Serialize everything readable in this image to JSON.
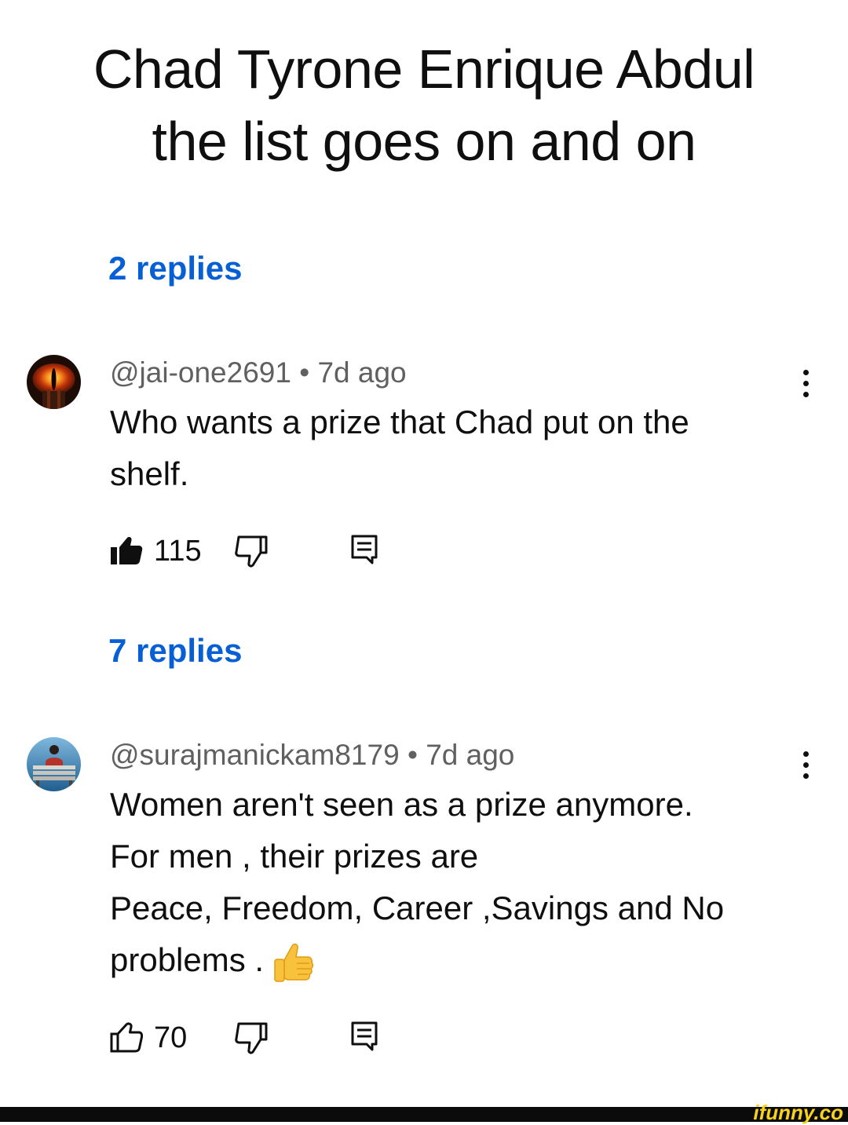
{
  "post": {
    "title_line1": "Chad Tyrone Enrique Abdul",
    "title_line2": "the list goes on and on"
  },
  "replies_link_1": "2 replies",
  "comments": [
    {
      "author": "@jai-one2691",
      "separator": " • ",
      "age": "7d ago",
      "text_lines": [
        "Who wants a prize that Chad put on the",
        "shelf."
      ],
      "like_count": "115",
      "liked": true,
      "avatar_icon": "eye-of-sauron-avatar"
    },
    {
      "author": "@surajmanickam8179",
      "separator": " • ",
      "age": "7d ago",
      "text_lines": [
        "Women aren't seen as a prize anymore.",
        "For men , their prizes are",
        "Peace, Freedom, Career ,Savings and No",
        "problems . "
      ],
      "emoji": "thumbs-up-emoji",
      "like_count": "70",
      "liked": false,
      "avatar_icon": "man-on-bench-avatar"
    }
  ],
  "replies_link_2": "7 replies",
  "watermark": "ifunny.co",
  "colors": {
    "link": "#065fd4",
    "meta": "#606060",
    "text": "#0f0f0f",
    "watermark": "#f7d21b"
  }
}
